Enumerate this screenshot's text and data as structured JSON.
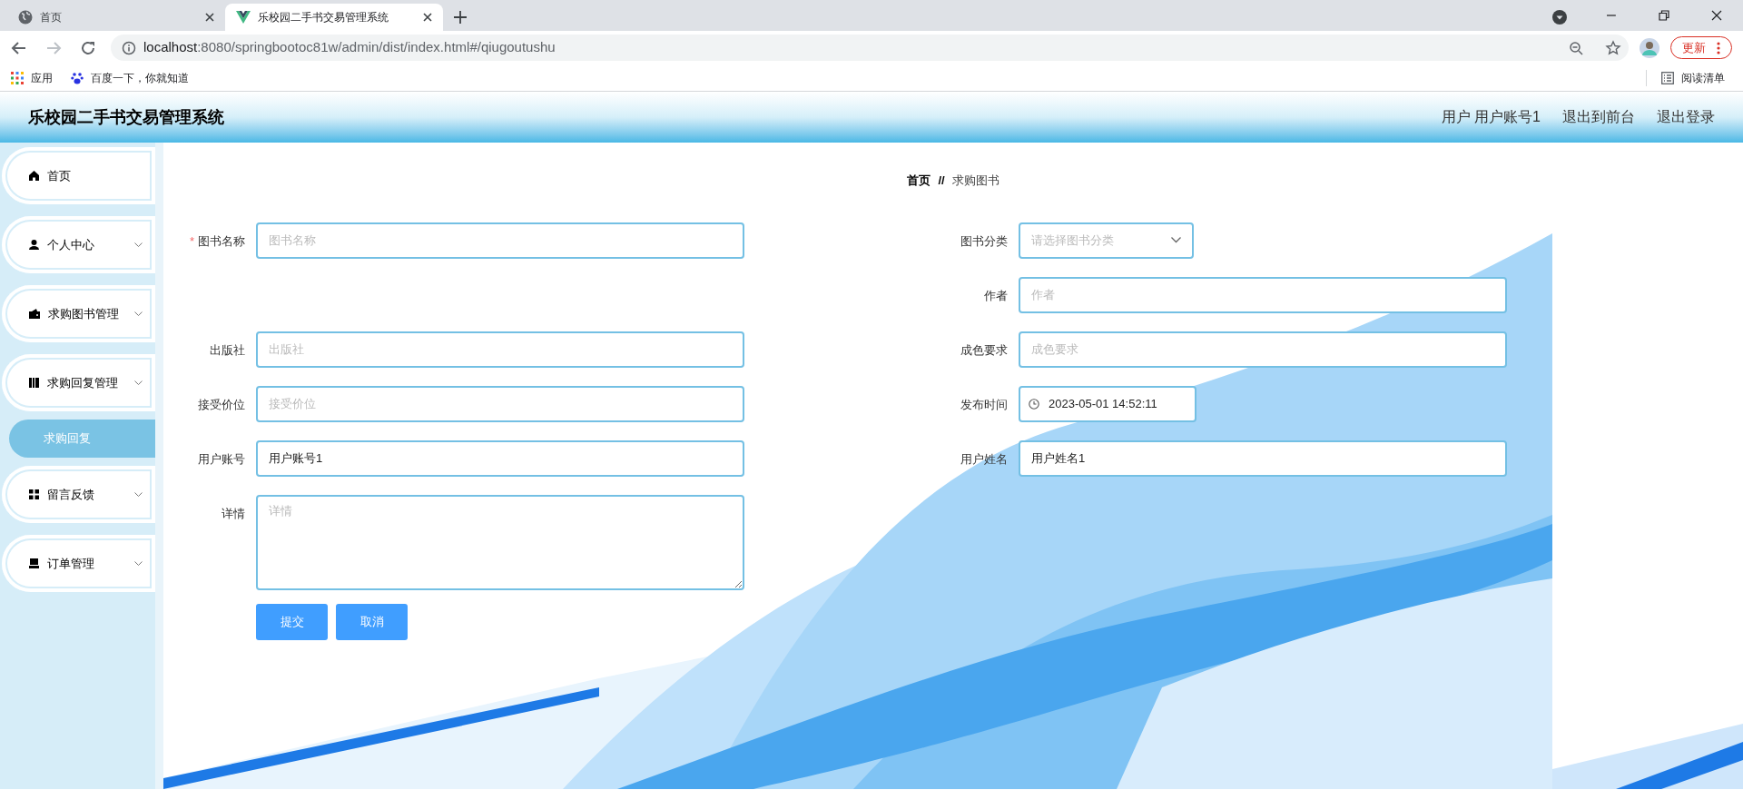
{
  "browser": {
    "tabs": [
      {
        "title": "首页",
        "selected": false
      },
      {
        "title": "乐校园二手书交易管理系统",
        "selected": true
      }
    ],
    "address": {
      "host": "localhost",
      "rest": ":8080/springbootoc81w/admin/dist/index.html#/qiugoutushu"
    },
    "update_button": "更新",
    "bookmarks": [
      "应用",
      "百度一下，你就知道"
    ],
    "reading_list": "阅读清单"
  },
  "header": {
    "title": "乐校园二手书交易管理系统",
    "links": [
      "用户 用户账号1",
      "退出到前台",
      "退出登录"
    ]
  },
  "sidebar": {
    "items": [
      {
        "label": "首页",
        "kind": "link"
      },
      {
        "label": "个人中心",
        "kind": "menu"
      },
      {
        "label": "求购图书管理",
        "kind": "menu"
      },
      {
        "label": "求购回复管理",
        "kind": "menu",
        "children": [
          {
            "label": "求购回复",
            "selected": true
          }
        ]
      },
      {
        "label": "留言反馈",
        "kind": "menu"
      },
      {
        "label": "订单管理",
        "kind": "menu"
      }
    ]
  },
  "breadcrumb": [
    {
      "kind": "link",
      "text": "首页"
    },
    {
      "kind": "separator",
      "text": "//"
    },
    {
      "kind": "current",
      "text": "求购图书"
    }
  ],
  "form": {
    "left_fields": [
      {
        "label": "图书名称",
        "required_mark": "*",
        "kind": "text",
        "placeholder": "图书名称"
      },
      {
        "label": "出版社",
        "kind": "text",
        "placeholder": "出版社"
      },
      {
        "label": "接受价位",
        "kind": "text",
        "placeholder": "接受价位"
      },
      {
        "label": "用户账号",
        "kind": "text",
        "value": "用户账号1"
      },
      {
        "label": "详情",
        "kind": "textarea",
        "placeholder": "详情"
      }
    ],
    "right_fields": [
      {
        "label": "图书分类",
        "kind": "select",
        "placeholder": "请选择图书分类"
      },
      {
        "label": "作者",
        "kind": "text",
        "placeholder": "作者"
      },
      {
        "label": "成色要求",
        "kind": "text",
        "placeholder": "成色要求"
      },
      {
        "label": "发布时间",
        "kind": "date",
        "value": "2023-05-01 14:52:11"
      },
      {
        "label": "用户姓名",
        "kind": "text",
        "value": "用户姓名1"
      }
    ],
    "buttons": [
      "提交",
      "取消"
    ]
  }
}
